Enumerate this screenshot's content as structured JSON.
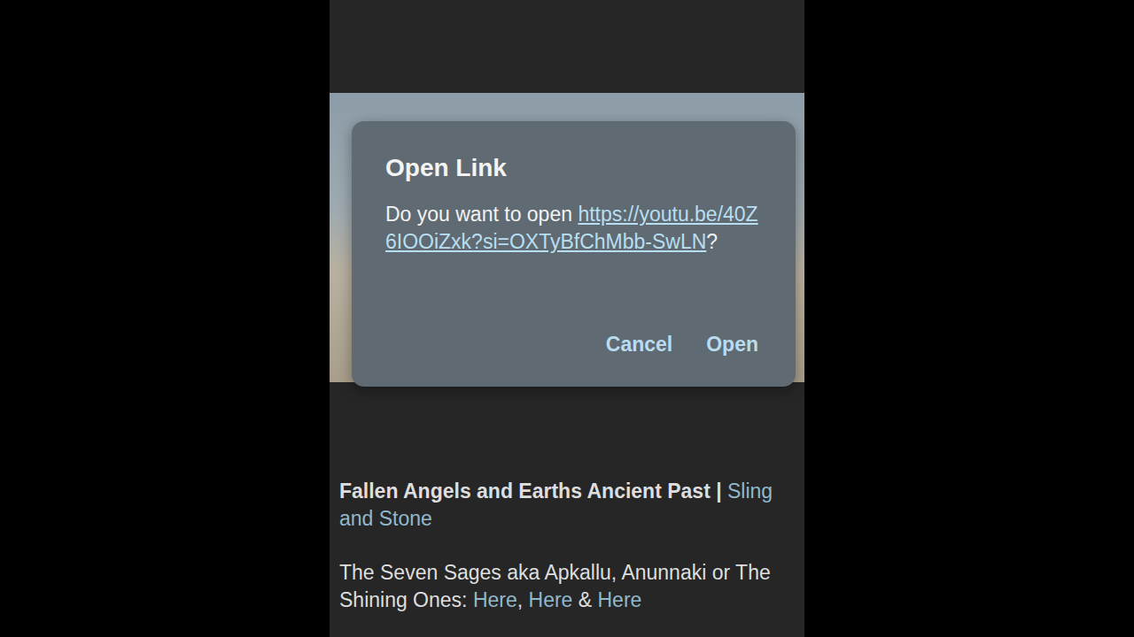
{
  "dialog": {
    "title": "Open Link",
    "message": [
      {
        "text": "Do you want to open ",
        "kind": "text"
      },
      {
        "text": "https://youtu.be/40Z6IOOiZxk?si=OXTyBfChMbb-SwLN",
        "kind": "link"
      },
      {
        "text": "?",
        "kind": "text"
      }
    ],
    "buttons": [
      "Cancel",
      "Open"
    ]
  },
  "post": {
    "title": [
      {
        "text": "Fallen Angels and Earths Ancient Past | ",
        "kind": "text"
      },
      {
        "text": "Sling and Stone",
        "kind": "link"
      }
    ],
    "line": [
      {
        "text": "The Seven Sages aka Apkallu, Anunnaki or The Shining Ones: ",
        "kind": "text"
      },
      {
        "text": "Here",
        "kind": "link"
      },
      {
        "text": ", ",
        "kind": "text"
      },
      {
        "text": "Here",
        "kind": "link"
      },
      {
        "text": " & ",
        "kind": "text"
      },
      {
        "text": "Here",
        "kind": "link"
      }
    ]
  }
}
